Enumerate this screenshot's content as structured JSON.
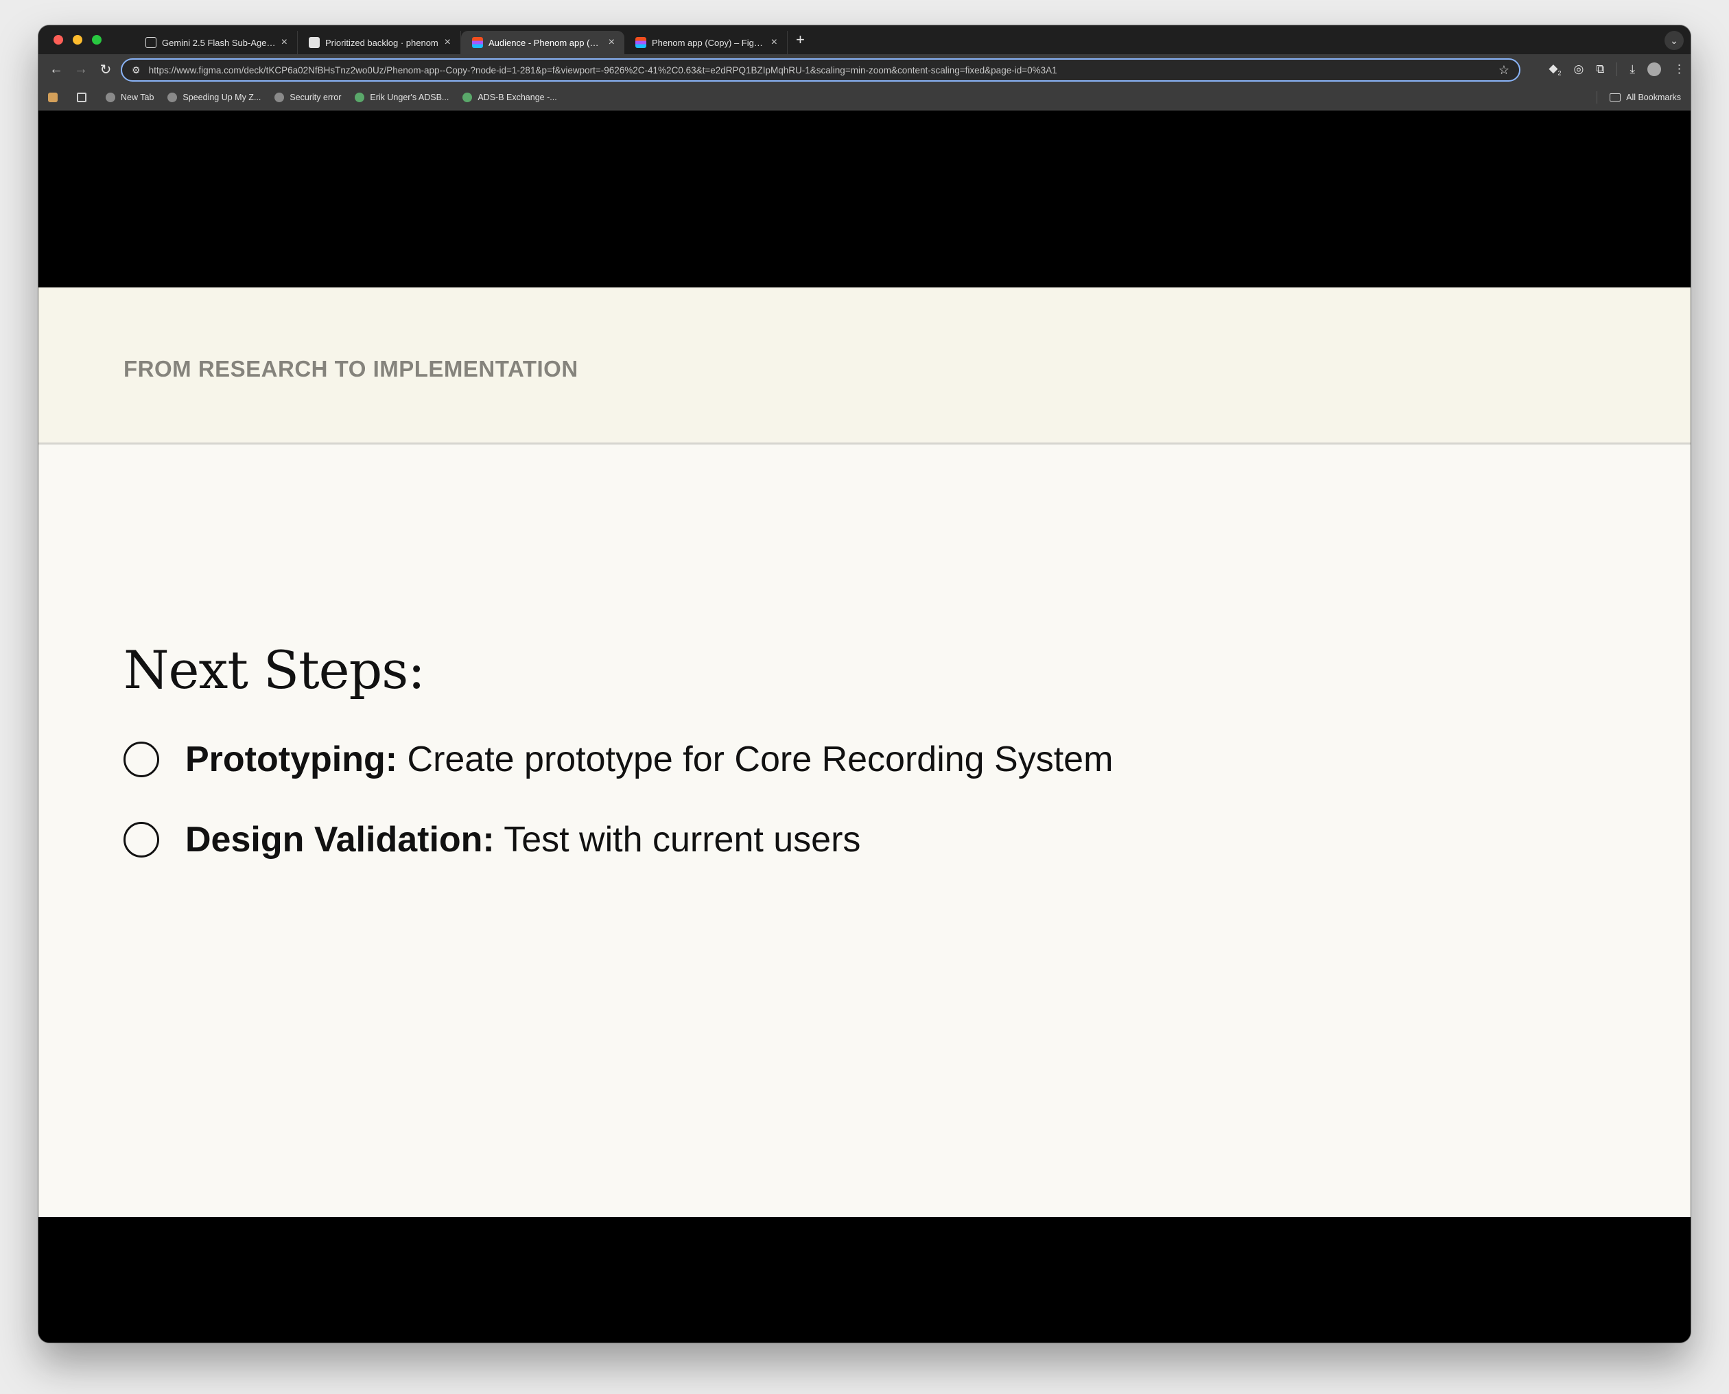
{
  "browser": {
    "tabs": [
      {
        "title": "Gemini 2.5 Flash Sub-Agent –",
        "icon": "gemini-icon",
        "active": false
      },
      {
        "title": "Prioritized backlog · phenom",
        "icon": "github-icon",
        "active": false
      },
      {
        "title": "Audience - Phenom app (Copy)",
        "icon": "figma-icon",
        "active": true
      },
      {
        "title": "Phenom app (Copy) – Figma",
        "icon": "figma-icon",
        "active": false
      }
    ],
    "url": "https://www.figma.com/deck/tKCP6a02NfBHsTnz2wo0Uz/Phenom-app--Copy-?node-id=1-281&p=f&viewport=-9626%2C-41%2C0.63&t=e2dRPQ1BZIpMqhRU-1&scaling=min-zoom&content-scaling=fixed&page-id=0%3A1",
    "extension_badge": "2",
    "bookmarks": [
      {
        "label": "New Tab"
      },
      {
        "label": "Speeding Up My Z..."
      },
      {
        "label": "Security error"
      },
      {
        "label": "Erik Unger's ADSB..."
      },
      {
        "label": "ADS-B Exchange -..."
      }
    ],
    "all_bookmarks_label": "All Bookmarks"
  },
  "slide": {
    "eyebrow": "FROM RESEARCH TO IMPLEMENTATION",
    "title": "Next Steps:",
    "steps": [
      {
        "label": "Prototyping:",
        "text": " Create prototype for Core Recording System"
      },
      {
        "label": "Design Validation:",
        "text": " Test with current users"
      }
    ]
  },
  "colors": {
    "slide_background": "#faf9f4",
    "header_background": "#f7f5ea",
    "eyebrow_text": "#85837c",
    "body_text": "#111111",
    "letterbox": "#000000"
  }
}
